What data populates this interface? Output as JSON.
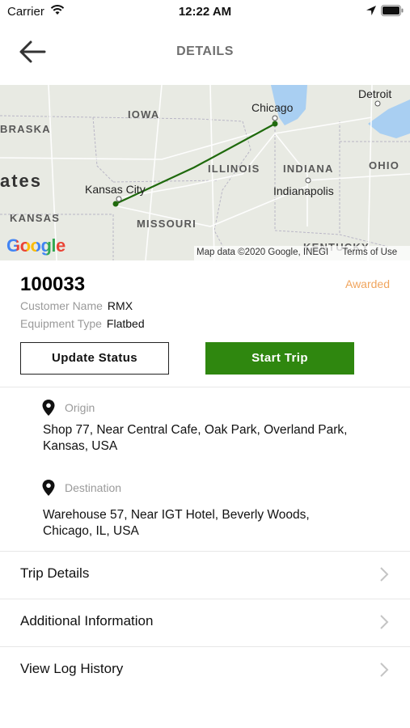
{
  "status_bar": {
    "carrier": "Carrier",
    "time": "12:22 AM"
  },
  "header": {
    "title": "DETAILS"
  },
  "map": {
    "region_labels": [
      "IOWA",
      "BRASKA",
      "ates",
      "KANSAS",
      "MISSOURI",
      "ILLINOIS",
      "INDIANA",
      "OHIO",
      "KENTUCKY"
    ],
    "cities": [
      "Chicago",
      "Detroit",
      "Kansas City",
      "Indianapolis"
    ],
    "logo_text": "Google",
    "attribution": "Map data ©2020 Google, INEGI",
    "terms": "Terms of Use",
    "route_color": "#1f6a0d"
  },
  "load": {
    "id": "100033",
    "status": "Awarded",
    "customer_label": "Customer Name",
    "customer_value": "RMX",
    "equipment_label": "Equipment Type",
    "equipment_value": "Flatbed"
  },
  "actions": {
    "update_status": "Update Status",
    "start_trip": "Start Trip"
  },
  "origin": {
    "label": "Origin",
    "address_line1": "Shop 77, Near Central Cafe, Oak Park, Overland Park,",
    "address_line2": "Kansas, USA"
  },
  "destination": {
    "label": "Destination",
    "address_line1": "Warehouse 57, Near IGT Hotel, Beverly Woods,",
    "address_line2": "Chicago, IL, USA"
  },
  "menu": [
    {
      "label": "Trip Details"
    },
    {
      "label": "Additional Information"
    },
    {
      "label": "View Log History"
    }
  ],
  "colors": {
    "accent_green": "#2f870f",
    "status_orange": "#f0a55e"
  }
}
